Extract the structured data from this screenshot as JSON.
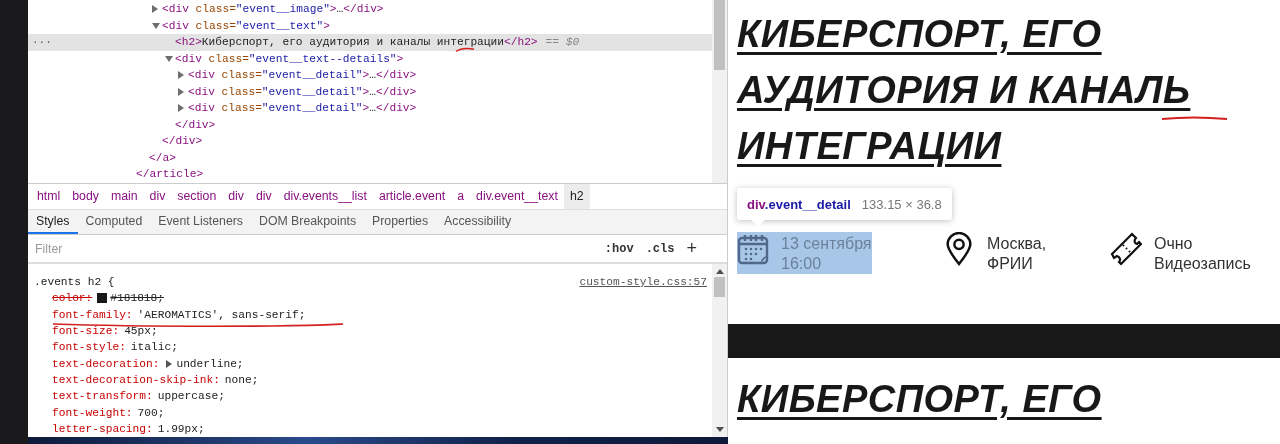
{
  "devtools": {
    "dom_tree": [
      {
        "close": [
          {
            "kind": "tag",
            "text": "</article>"
          }
        ],
        "children": [
          {
            "close": [
              {
                "kind": "tag",
                "text": "</a>"
              }
            ],
            "children": [
              {
                "selected": false,
                "expanded": false,
                "tokens": [
                  {
                    "kind": "tag",
                    "text": "<div"
                  },
                  {
                    "kind": "attr",
                    "text": " class="
                  },
                  {
                    "kind": "val",
                    "text": "\"event__image\""
                  },
                  {
                    "kind": "tag",
                    "text": ">"
                  },
                  {
                    "kind": "text",
                    "text": "…"
                  },
                  {
                    "kind": "tag",
                    "text": "</div>"
                  }
                ]
              },
              {
                "selected": false,
                "expanded": true,
                "tokens": [
                  {
                    "kind": "tag",
                    "text": "<div"
                  },
                  {
                    "kind": "attr",
                    "text": " class="
                  },
                  {
                    "kind": "val",
                    "text": "\"event__text\""
                  },
                  {
                    "kind": "tag",
                    "text": ">"
                  }
                ],
                "close": [
                  {
                    "kind": "tag",
                    "text": "</div>"
                  }
                ],
                "children": [
                  {
                    "selected": true,
                    "gutter": "···",
                    "suffix": "== $0",
                    "tokens": [
                      {
                        "kind": "tag",
                        "text": "<h2>"
                      },
                      {
                        "kind": "text",
                        "text": "Киберспорт, его аудитория и каналы интеграции"
                      },
                      {
                        "kind": "tag",
                        "text": "</h2>"
                      }
                    ]
                  },
                  {
                    "selected": false,
                    "expanded": true,
                    "tokens": [
                      {
                        "kind": "tag",
                        "text": "<div"
                      },
                      {
                        "kind": "attr",
                        "text": " class="
                      },
                      {
                        "kind": "val",
                        "text": "\"event__text--details\""
                      },
                      {
                        "kind": "tag",
                        "text": ">"
                      }
                    ],
                    "close": [
                      {
                        "kind": "tag",
                        "text": "</div>"
                      }
                    ],
                    "children": [
                      {
                        "selected": false,
                        "expanded": false,
                        "tokens": [
                          {
                            "kind": "tag",
                            "text": "<div"
                          },
                          {
                            "kind": "attr",
                            "text": " class="
                          },
                          {
                            "kind": "val",
                            "text": "\"event__detail\""
                          },
                          {
                            "kind": "tag",
                            "text": ">"
                          },
                          {
                            "kind": "text",
                            "text": "…"
                          },
                          {
                            "kind": "tag",
                            "text": "</div>"
                          }
                        ]
                      },
                      {
                        "selected": false,
                        "expanded": false,
                        "tokens": [
                          {
                            "kind": "tag",
                            "text": "<div"
                          },
                          {
                            "kind": "attr",
                            "text": " class="
                          },
                          {
                            "kind": "val",
                            "text": "\"event__detail\""
                          },
                          {
                            "kind": "tag",
                            "text": ">"
                          },
                          {
                            "kind": "text",
                            "text": "…"
                          },
                          {
                            "kind": "tag",
                            "text": "</div>"
                          }
                        ]
                      },
                      {
                        "selected": false,
                        "expanded": false,
                        "tokens": [
                          {
                            "kind": "tag",
                            "text": "<div"
                          },
                          {
                            "kind": "attr",
                            "text": " class="
                          },
                          {
                            "kind": "val",
                            "text": "\"event__detail\""
                          },
                          {
                            "kind": "tag",
                            "text": ">"
                          },
                          {
                            "kind": "text",
                            "text": "…"
                          },
                          {
                            "kind": "tag",
                            "text": "</div>"
                          }
                        ]
                      }
                    ]
                  }
                ]
              }
            ]
          }
        ]
      }
    ],
    "breadcrumbs": [
      {
        "label": "html",
        "selected": false
      },
      {
        "label": "body",
        "selected": false
      },
      {
        "label": "main",
        "selected": false
      },
      {
        "label": "div",
        "selected": false
      },
      {
        "label": "section",
        "selected": false
      },
      {
        "label": "div",
        "selected": false
      },
      {
        "label": "div",
        "selected": false
      },
      {
        "label": "div.events__list",
        "selected": false
      },
      {
        "label": "article.event",
        "selected": false
      },
      {
        "label": "a",
        "selected": false
      },
      {
        "label": "div.event__text",
        "selected": false
      },
      {
        "label": "h2",
        "selected": true
      }
    ],
    "tabs": [
      {
        "label": "Styles",
        "selected": true
      },
      {
        "label": "Computed",
        "selected": false
      },
      {
        "label": "Event Listeners",
        "selected": false
      },
      {
        "label": "DOM Breakpoints",
        "selected": false
      },
      {
        "label": "Properties",
        "selected": false
      },
      {
        "label": "Accessibility",
        "selected": false
      }
    ],
    "filter": {
      "placeholder": "Filter"
    },
    "filter_buttons": [
      ":hov",
      ".cls",
      "+"
    ],
    "rule": {
      "selector": ".events h2 {",
      "source": "custom-style.css:57",
      "declarations": [
        {
          "property": "color:",
          "value": "#181818;",
          "struck": true,
          "color": "#181818",
          "expandable": false
        },
        {
          "property": "font-family:",
          "value": "'AEROMATICS', sans-serif;",
          "struck": false,
          "expandable": false
        },
        {
          "property": "font-size:",
          "value": "45px;",
          "struck": false,
          "expandable": false
        },
        {
          "property": "font-style:",
          "value": "italic;",
          "struck": false,
          "expandable": false
        },
        {
          "property": "text-decoration:",
          "value": "underline;",
          "struck": false,
          "expandable": true
        },
        {
          "property": "text-decoration-skip-ink:",
          "value": "none;",
          "struck": false,
          "expandable": false
        },
        {
          "property": "text-transform:",
          "value": "uppercase;",
          "struck": false,
          "expandable": false
        },
        {
          "property": "font-weight:",
          "value": "700;",
          "struck": false,
          "expandable": false
        },
        {
          "property": "letter-spacing:",
          "value": "1.99px;",
          "struck": false,
          "expandable": false
        }
      ]
    }
  },
  "page": {
    "title": "КИБЕРСПОРТ, ЕГО АУДИТОРИЯ И КАНАЛЬ ИНТЕГРАЦИИ",
    "tooltip": {
      "tag": "div",
      "classes": ".event__detail",
      "size": "133.15 × 36.8"
    },
    "details": [
      {
        "kind": "date",
        "lines": [
          "13 сентября",
          "16:00"
        ],
        "highlighted": true
      },
      {
        "kind": "location",
        "lines": [
          "Москва,",
          "ФРИИ"
        ],
        "highlighted": false
      },
      {
        "kind": "ticket",
        "lines": [
          "Очно",
          "Видеозапись"
        ],
        "highlighted": false
      }
    ],
    "next_title": "КИБЕРСПОРТ, ЕГО"
  }
}
